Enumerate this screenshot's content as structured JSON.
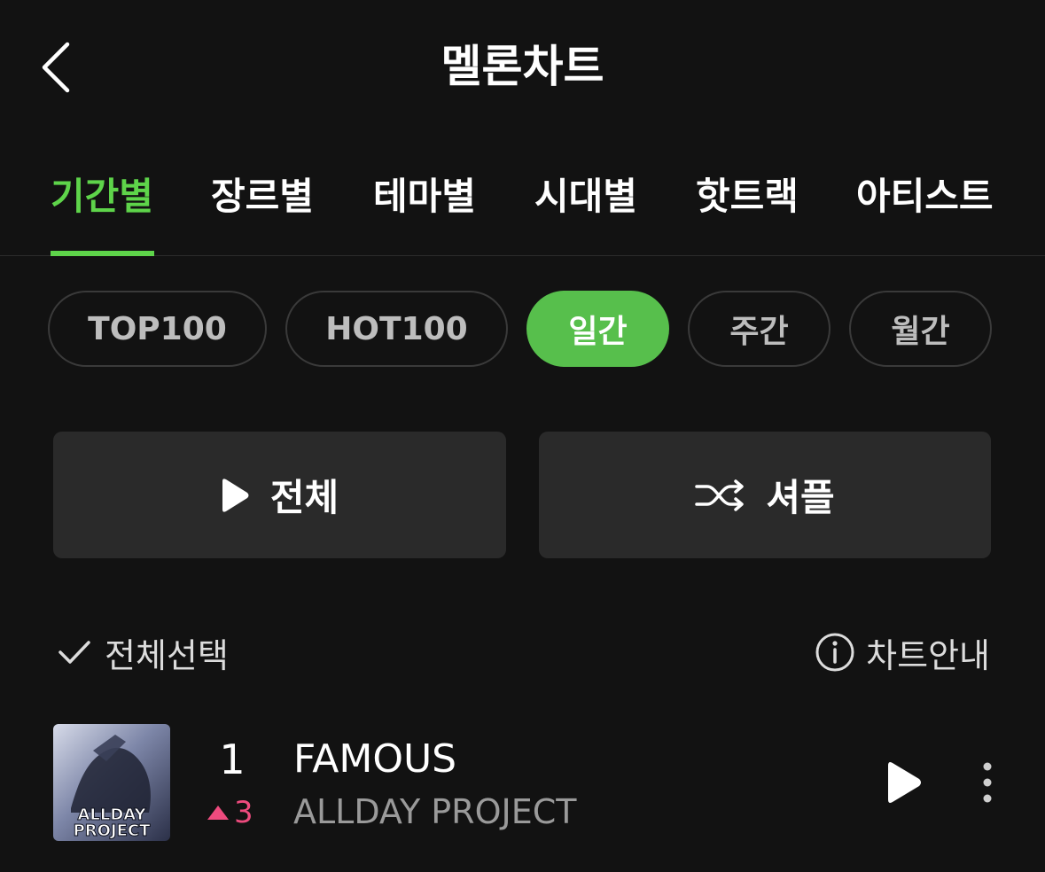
{
  "header": {
    "title": "멜론차트",
    "back_icon": "chevron-left-icon"
  },
  "tabs": [
    {
      "label": "기간별",
      "active": true
    },
    {
      "label": "장르별",
      "active": false
    },
    {
      "label": "테마별",
      "active": false
    },
    {
      "label": "시대별",
      "active": false
    },
    {
      "label": "핫트랙",
      "active": false
    },
    {
      "label": "아티스트",
      "active": false
    }
  ],
  "pills": [
    {
      "label": "TOP100",
      "active": false
    },
    {
      "label": "HOT100",
      "active": false
    },
    {
      "label": "일간",
      "active": true
    },
    {
      "label": "주간",
      "active": false
    },
    {
      "label": "월간",
      "active": false
    }
  ],
  "actions": {
    "play_all_label": "전체",
    "play_icon": "play-icon",
    "shuffle_label": "셔플",
    "shuffle_icon": "shuffle-icon"
  },
  "list_controls": {
    "select_all_label": "전체선택",
    "select_all_icon": "checkmark-icon",
    "chart_info_label": "차트안내",
    "chart_info_icon": "info-icon"
  },
  "songs": [
    {
      "rank": "1",
      "rank_change": "3",
      "rank_change_direction": "up",
      "title": "FAMOUS",
      "artist": "ALLDAY PROJECT",
      "album_art_text_line1": "ALLDAY",
      "album_art_text_line2": "PROJECT"
    }
  ],
  "colors": {
    "background": "#121212",
    "accent_green": "#5ed44a",
    "pill_active": "#57bf4c",
    "rank_up": "#ee4b7e",
    "button_bg": "#2a2a2a"
  }
}
